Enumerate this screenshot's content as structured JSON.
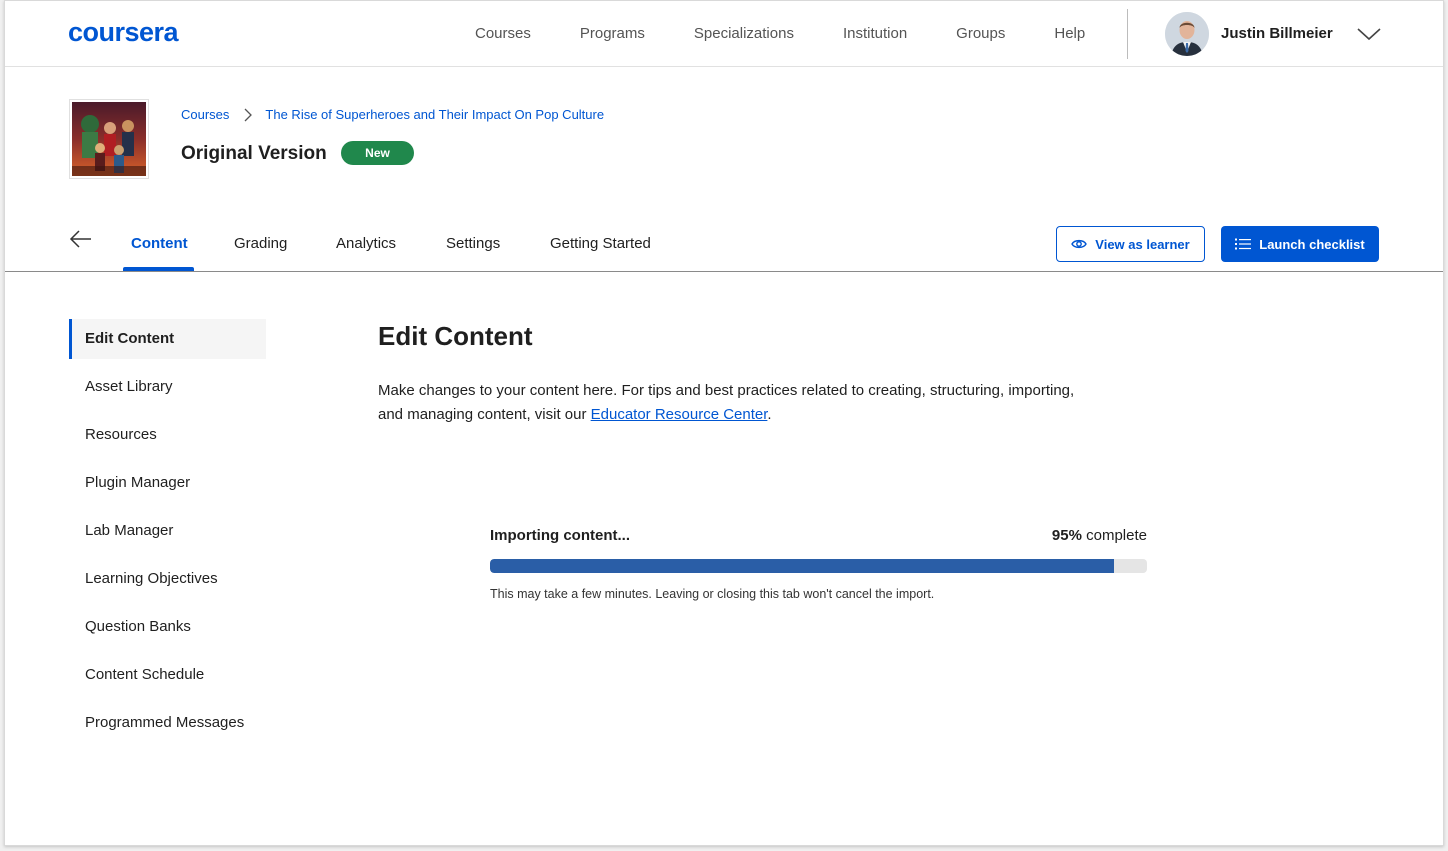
{
  "header": {
    "logo": "coursera",
    "nav": [
      "Courses",
      "Programs",
      "Specializations",
      "Institution",
      "Groups",
      "Help"
    ],
    "user_name": "Justin Billmeier"
  },
  "course": {
    "breadcrumb_root": "Courses",
    "breadcrumb_course": "The Rise of Superheroes and Their Impact On Pop Culture",
    "version_title": "Original Version",
    "badge": "New"
  },
  "tabs": [
    "Content",
    "Grading",
    "Analytics",
    "Settings",
    "Getting Started"
  ],
  "active_tab": "Content",
  "actions": {
    "view_as_learner": "View as learner",
    "launch_checklist": "Launch checklist"
  },
  "sidebar": {
    "items": [
      "Edit Content",
      "Asset Library",
      "Resources",
      "Plugin Manager",
      "Lab Manager",
      "Learning Objectives",
      "Question Banks",
      "Content Schedule",
      "Programmed Messages"
    ],
    "active": "Edit Content"
  },
  "main": {
    "title": "Edit Content",
    "description_before_link": "Make changes to your content here. For tips and best practices related to creating, structuring, importing, and managing content, visit our ",
    "link_text": "Educator Resource Center",
    "description_after_link": "."
  },
  "import": {
    "label": "Importing content...",
    "percent": "95%",
    "percent_suffix": "complete",
    "progress": 0.95,
    "note": "This may take a few minutes. Leaving or closing this tab won't cancel the import."
  },
  "colors": {
    "brand": "#0056d2",
    "badge": "#20884c",
    "progress_fill": "#2a5ea7",
    "progress_track": "#e5e5e5"
  },
  "icons": [
    "user-avatar",
    "chevron-down-icon",
    "chevron-right-icon",
    "arrow-left-icon",
    "eye-icon",
    "list-icon"
  ]
}
